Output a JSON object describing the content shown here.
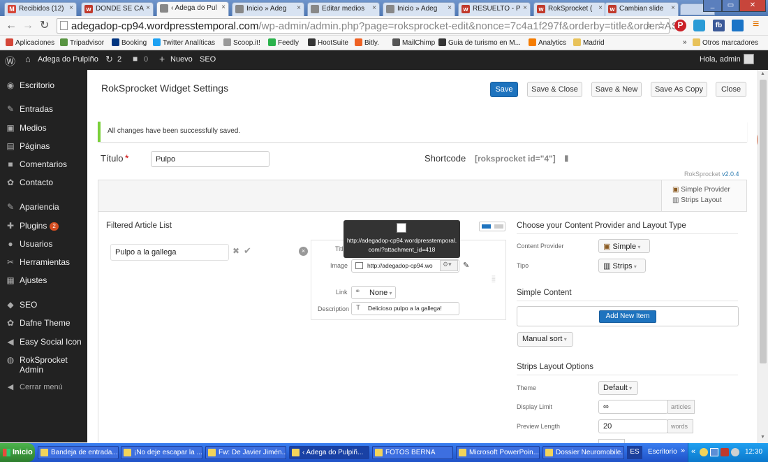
{
  "browser": {
    "tabs": [
      {
        "label": "Recibidos (12)",
        "icon": "gmail-icon",
        "color": "#d44638",
        "glyph": "M"
      },
      {
        "label": "DONDE SE CA",
        "icon": "wix-icon",
        "color": "#c0392b",
        "glyph": "w"
      },
      {
        "label": "‹ Adega do Pul",
        "icon": "page-icon",
        "color": "#888",
        "glyph": ""
      },
      {
        "label": "Inicio » Adeg",
        "icon": "page-icon",
        "color": "#888",
        "glyph": ""
      },
      {
        "label": "Editar medios",
        "icon": "page-icon",
        "color": "#888",
        "glyph": ""
      },
      {
        "label": "Inicio » Adeg",
        "icon": "page-icon",
        "color": "#888",
        "glyph": ""
      },
      {
        "label": "RESUELTO - P",
        "icon": "wix-icon",
        "color": "#c0392b",
        "glyph": "w"
      },
      {
        "label": "RokSprocket (",
        "icon": "wix-icon",
        "color": "#c0392b",
        "glyph": "w"
      },
      {
        "label": "Cambian slide",
        "icon": "wix-icon",
        "color": "#c0392b",
        "glyph": "w"
      }
    ],
    "url_host": "adegadop-cp94.wordpresstemporal.com",
    "url_path": "/wp-admin/admin.php?page=roksprocket-edit&nonce=7c4a1f297f&orderby=title&order=ASC",
    "bookmarks": [
      {
        "label": "Aplicaciones",
        "color": "#d44638"
      },
      {
        "label": "Tripadvisor",
        "color": "#589442"
      },
      {
        "label": "Booking",
        "color": "#003580"
      },
      {
        "label": "Twitter Analíticas",
        "color": "#1da1f2"
      },
      {
        "label": "Scoop.it!",
        "color": "#999"
      },
      {
        "label": "Feedly",
        "color": "#2bb24c"
      },
      {
        "label": "HootSuite",
        "color": "#333"
      },
      {
        "label": "Bitly.",
        "color": "#ee6123"
      },
      {
        "label": "MailChimp",
        "color": "#555"
      },
      {
        "label": "Guia de turismo en M...",
        "color": "#333"
      },
      {
        "label": "Analytics",
        "color": "#f57c00"
      },
      {
        "label": "Madrid",
        "color": "#e8c25a"
      }
    ],
    "other_bookmarks": "Otros marcadores",
    "more": "»"
  },
  "adminbar": {
    "site": "Adega do Pulpiño",
    "updates": "2",
    "comments": "0",
    "new": "Nuevo",
    "seo": "SEO",
    "greeting": "Hola, admin"
  },
  "sidebar": {
    "items": [
      {
        "label": "Escritorio",
        "icon": "dashboard-icon",
        "glyph": "◉"
      },
      {
        "label": "Entradas",
        "icon": "pin-icon",
        "glyph": "✎"
      },
      {
        "label": "Medios",
        "icon": "media-icon",
        "glyph": "▣"
      },
      {
        "label": "Páginas",
        "icon": "pages-icon",
        "glyph": "▤"
      },
      {
        "label": "Comentarios",
        "icon": "comments-icon",
        "glyph": "■"
      },
      {
        "label": "Contacto",
        "icon": "contact-icon",
        "glyph": "✿"
      },
      {
        "label": "Apariencia",
        "icon": "appearance-icon",
        "glyph": "✎"
      },
      {
        "label": "Plugins",
        "icon": "plugins-icon",
        "glyph": "✚",
        "badge": "2"
      },
      {
        "label": "Usuarios",
        "icon": "users-icon",
        "glyph": "●"
      },
      {
        "label": "Herramientas",
        "icon": "tools-icon",
        "glyph": "✂"
      },
      {
        "label": "Ajustes",
        "icon": "settings-icon",
        "glyph": "▦"
      },
      {
        "label": "SEO",
        "icon": "seo-icon",
        "glyph": "◆"
      },
      {
        "label": "Dafne Theme",
        "icon": "gear-icon",
        "glyph": "✿"
      },
      {
        "label": "Easy Social Icon",
        "icon": "share-icon",
        "glyph": "◀"
      },
      {
        "label": "RokSprocket\nAdmin",
        "icon": "roksprocket-icon",
        "glyph": "◍"
      },
      {
        "label": "Cerrar menú",
        "icon": "collapse-icon",
        "glyph": "◀"
      }
    ]
  },
  "page": {
    "title": "RokSprocket Widget Settings",
    "buttons": {
      "save": "Save",
      "save_close": "Save & Close",
      "save_new": "Save & New",
      "save_copy": "Save As Copy",
      "close": "Close"
    },
    "notice": "All changes have been successfully saved.",
    "title_label": "Título",
    "required": "*",
    "title_value": "Pulpo",
    "shortcode_label": "Shortcode",
    "shortcode_value": "[roksprocket id=\"4\"]",
    "version_prefix": "RokSprocket",
    "version": "v2.0.4",
    "provider_summary": "Simple Provider",
    "layout_summary": "Strips Layout"
  },
  "article_list": {
    "heading": "Filtered Article List",
    "item_title": "Pulpo a la gallega",
    "tooltip": "http://adegadop-cp94.wordpresstemporal.com/?attachment_id=418",
    "fields": {
      "title_label": "Title",
      "image_label": "Image",
      "image_value": "http://adegadop-cp94.wo",
      "link_label": "Link",
      "link_value": "None",
      "description_label": "Description",
      "description_value": "Delicioso pulpo a la gallega!"
    }
  },
  "right_panel": {
    "provider_heading": "Choose your Content Provider and Layout Type",
    "content_provider_label": "Content Provider",
    "content_provider_value": "Simple",
    "tipo_label": "Tipo",
    "tipo_value": "Strips",
    "simple_content_heading": "Simple Content",
    "add_item": "Add New Item",
    "manual_sort": "Manual sort",
    "strips_heading": "Strips Layout Options",
    "theme_label": "Theme",
    "theme_value": "Default",
    "display_limit_label": "Display Limit",
    "display_limit_value": "∞",
    "display_limit_unit": "articles",
    "preview_length_label": "Preview Length",
    "preview_length_value": "20",
    "preview_length_unit": "words"
  },
  "taskbar": {
    "start": "Inicio",
    "items": [
      "Bandeja de entrada...",
      "¡No deje escapar la ...",
      "Fw: De Javier Jimén...",
      "‹ Adega do Pulpiñ...",
      "FOTOS BERNA",
      "Microsoft PowerPoin...",
      "Dossier Neuromobile..."
    ],
    "lang": "ES",
    "desktop": "Escritorio",
    "clock": "12:30"
  }
}
